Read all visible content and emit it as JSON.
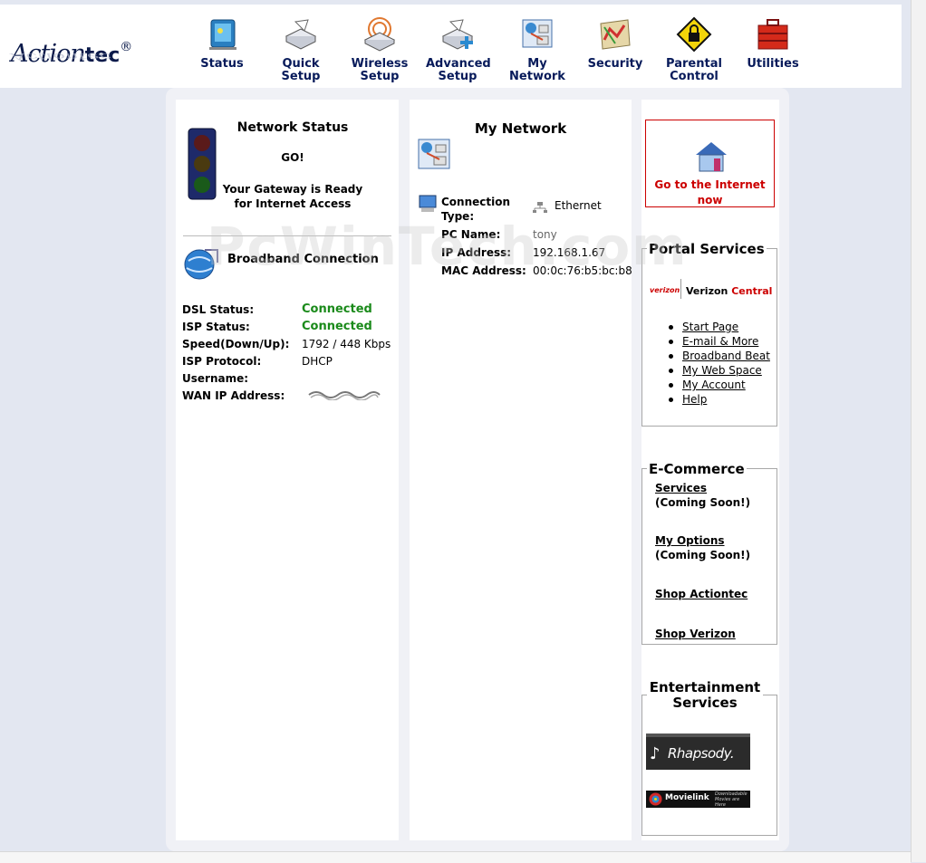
{
  "header": {
    "logo_main": "Action",
    "logo_tec": "tec",
    "logo_reg": "®",
    "nav": [
      {
        "id": "status",
        "line1": "Status",
        "line2": "",
        "icon": "status-icon"
      },
      {
        "id": "quick-setup",
        "line1": "Quick",
        "line2": "Setup",
        "icon": "quick-setup-icon"
      },
      {
        "id": "wireless-setup",
        "line1": "Wireless",
        "line2": "Setup",
        "icon": "wireless-setup-icon"
      },
      {
        "id": "advanced-setup",
        "line1": "Advanced",
        "line2": "Setup",
        "icon": "advanced-setup-icon"
      },
      {
        "id": "my-network",
        "line1": "My Network",
        "line2": "",
        "icon": "my-network-icon"
      },
      {
        "id": "security",
        "line1": "Security",
        "line2": "",
        "icon": "security-icon"
      },
      {
        "id": "parental-control",
        "line1": "Parental",
        "line2": "Control",
        "icon": "parental-control-icon"
      },
      {
        "id": "utilities",
        "line1": "Utilities",
        "line2": "",
        "icon": "utilities-icon"
      }
    ]
  },
  "network_status": {
    "title": "Network Status",
    "go": "GO!",
    "ready_line1": "Your Gateway is Ready",
    "ready_line2": "for Internet Access",
    "broadband_title": "Broadband Connection",
    "rows": [
      {
        "label": "DSL Status:",
        "value": "Connected",
        "highlight": true
      },
      {
        "label": "ISP Status:",
        "value": "Connected",
        "highlight": true
      },
      {
        "label": "Speed(Down/Up):",
        "value": "1792 / 448 Kbps",
        "highlight": false
      },
      {
        "label": "ISP Protocol:",
        "value": "DHCP",
        "highlight": false
      },
      {
        "label": "Username:",
        "value": "",
        "highlight": false
      },
      {
        "label": "WAN IP Address:",
        "value": "",
        "highlight": false
      }
    ]
  },
  "my_network": {
    "title": "My Network",
    "connection_label_1": "Connection",
    "connection_label_2": "Type:",
    "connection_value": "Ethernet",
    "pc_label": "PC Name:",
    "pc_value": "tony",
    "ip_label": "IP Address:",
    "ip_value": "192.168.1.67",
    "mac_label": "MAC Address:",
    "mac_value": "00:0c:76:b5:bc:b8"
  },
  "internet_box": {
    "line1": "Go to the Internet",
    "line2": "now"
  },
  "portal": {
    "title": "Portal Services",
    "verizon_small": "verizon",
    "verizon_central_1": "Verizon",
    "verizon_central_2": "Central",
    "links": [
      "Start Page",
      "E-mail & More",
      "Broadband Beat",
      "My Web Space",
      "My Account",
      "Help"
    ]
  },
  "ecommerce": {
    "title": "E-Commerce",
    "services": "Services",
    "services_note": "(Coming Soon!)",
    "options": "My Options",
    "options_note": "(Coming Soon!)",
    "shop_actiontec": "Shop Actiontec",
    "shop_verizon": "Shop Verizon"
  },
  "entertainment": {
    "title_1": "Entertainment",
    "title_2": "Services",
    "rhapsody": "Rhapsody.",
    "movielink": "Movielink",
    "movielink_tag_1": "Downloadable",
    "movielink_tag_2": "Movies are Here"
  },
  "watermark": "PcWinTech.com",
  "colors": {
    "accent_red": "#cc0000",
    "connected_green": "#1a8a1a",
    "nav_blue": "#071a5a"
  }
}
